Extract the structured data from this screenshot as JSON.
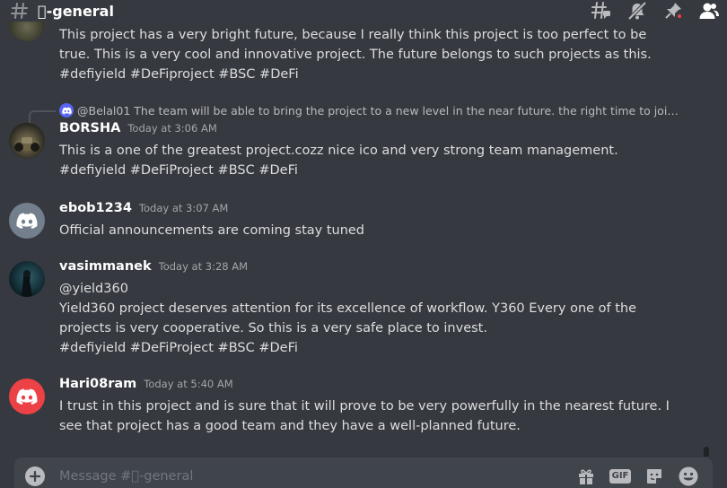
{
  "header": {
    "channel_name": "\u0000-general",
    "icons": [
      "threads-icon",
      "mute-notifications-icon",
      "pinned-messages-icon",
      "member-list-icon"
    ],
    "pinned_badge_color": "#ed4245"
  },
  "messages": [
    {
      "id": "partial",
      "text": "This project has a very bright future, because I really think this project is too perfect to be true. This is a very cool and innovative project. The future belongs to such projects as this. #defiyield #DeFiproject #BSC #DeFi"
    },
    {
      "id": "borsha",
      "reply": {
        "author": "@Belal01",
        "text": "The team will be able to bring the project to a new level in the near future. the right time to join the big..."
      },
      "author": "BORSHA",
      "timestamp": "Today at 3:06 AM",
      "lines": [
        "This is a one of the greatest project.cozz nice ico and very strong team management.",
        "#defiyield #DeFiProject #BSC #DeFi"
      ]
    },
    {
      "id": "ebob",
      "author": "ebob1234",
      "timestamp": "Today at 3:07 AM",
      "lines": [
        "Official announcements are coming stay tuned"
      ]
    },
    {
      "id": "vasim",
      "author": "vasimmanek",
      "timestamp": "Today at 3:28 AM",
      "lines": [
        "@yield360",
        "Yield360 project deserves attention for its excellence of workflow. Y360 Every one of the projects is very cooperative. So this is a very safe place to invest.",
        "#defiyield #DeFiProject #BSC #DeFi"
      ]
    },
    {
      "id": "hari",
      "author": "Hari08ram",
      "timestamp": "Today at 5:40 AM",
      "lines": [
        "I trust in this project and is sure that it will prove to be very powerfully in the nearest future. I see that project has a good team and they have a well-planned future."
      ]
    }
  ],
  "composer": {
    "placeholder": "Message #\u0000-general",
    "gif_label": "GIF",
    "icons": [
      "add-attachment-icon",
      "gift-icon",
      "gif-icon",
      "sticker-icon",
      "emoji-icon"
    ]
  },
  "colors": {
    "background": "#36393f",
    "composer": "#40444b",
    "discord_blurple": "#5865f2",
    "avatar_grey": "#747f8d",
    "avatar_red": "#ed4245"
  }
}
